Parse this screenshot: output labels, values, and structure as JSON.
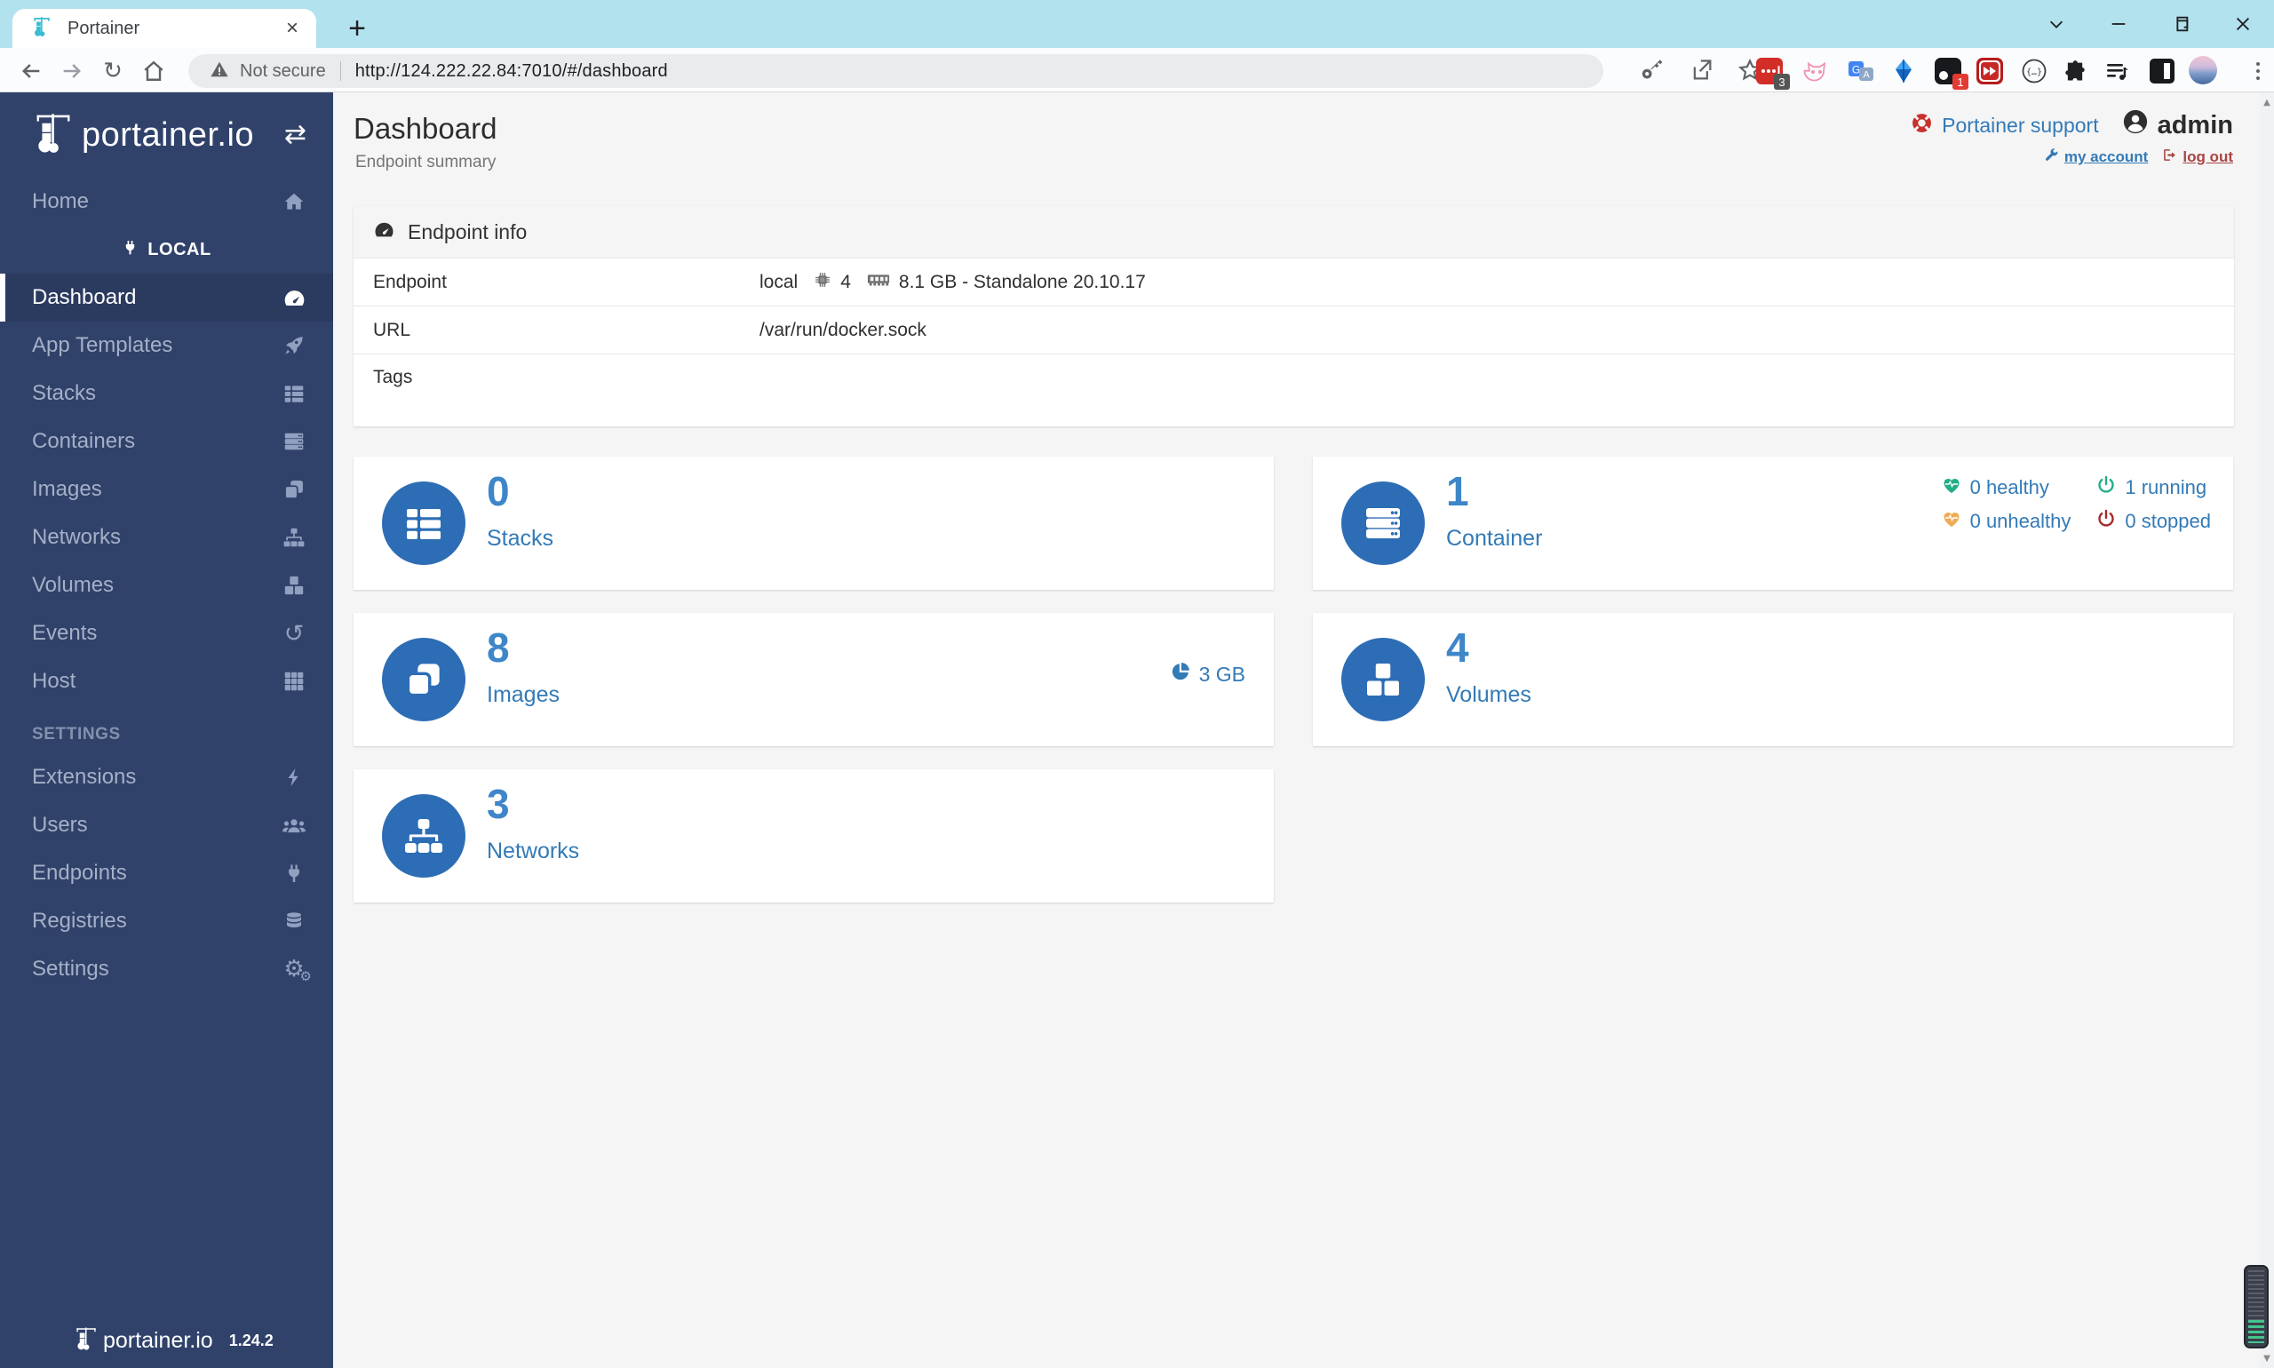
{
  "browser": {
    "tab": {
      "title": "Portainer"
    },
    "address": {
      "security": "Not secure",
      "url": "http://124.222.22.84:7010/#/dashboard"
    },
    "extensions": {
      "badge_a": "3",
      "badge_b": "1"
    }
  },
  "sidebar": {
    "brand": "portainer.io",
    "group_local": "LOCAL",
    "group_settings": "SETTINGS",
    "items": [
      {
        "label": "Home"
      },
      {
        "label": "Dashboard"
      },
      {
        "label": "App Templates"
      },
      {
        "label": "Stacks"
      },
      {
        "label": "Containers"
      },
      {
        "label": "Images"
      },
      {
        "label": "Networks"
      },
      {
        "label": "Volumes"
      },
      {
        "label": "Events"
      },
      {
        "label": "Host"
      },
      {
        "label": "Extensions"
      },
      {
        "label": "Users"
      },
      {
        "label": "Endpoints"
      },
      {
        "label": "Registries"
      },
      {
        "label": "Settings"
      }
    ],
    "footer": {
      "brand": "portainer.io",
      "version": "1.24.2"
    }
  },
  "header": {
    "title": "Dashboard",
    "subtitle": "Endpoint summary",
    "support": "Portainer support",
    "user": "admin",
    "my_account": "my account",
    "log_out": "log out"
  },
  "endpoint_info": {
    "title": "Endpoint info",
    "endpoint_label": "Endpoint",
    "endpoint_value": "local",
    "cpu_count": "4",
    "memory_info": "8.1 GB - Standalone 20.10.17",
    "url_label": "URL",
    "url_value": "/var/run/docker.sock",
    "tags_label": "Tags",
    "tags_value": ""
  },
  "cards": {
    "stacks": {
      "count": "0",
      "label": "Stacks"
    },
    "containers": {
      "count": "1",
      "label": "Container",
      "healthy": "0 healthy",
      "unhealthy": "0 unhealthy",
      "running": "1 running",
      "stopped": "0 stopped"
    },
    "images": {
      "count": "8",
      "label": "Images",
      "size": "3 GB"
    },
    "volumes": {
      "count": "4",
      "label": "Volumes"
    },
    "networks": {
      "count": "3",
      "label": "Networks"
    }
  },
  "colors": {
    "sidebar_navy": "#30426a",
    "active_navy": "#2b3a5f",
    "link_blue": "#337ab7",
    "circle_blue": "#2d6db5",
    "healthy_green": "#23ae89",
    "unhealthy_orange": "#eeac57",
    "stopped_red": "#a32b29",
    "support_red": "#c9302c",
    "tabstrip_blue": "#b3e2ef"
  }
}
